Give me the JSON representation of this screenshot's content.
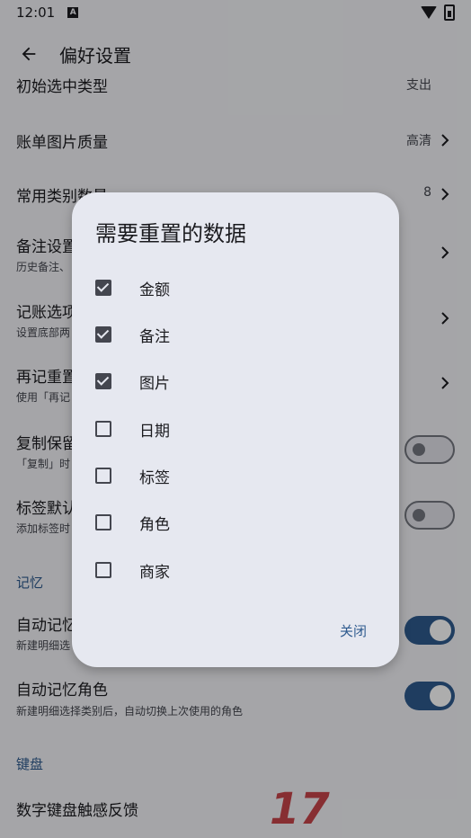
{
  "status_bar": {
    "time": "12:01",
    "notification_letter": "A"
  },
  "app_bar": {
    "title": "偏好设置"
  },
  "settings": {
    "partial_top": {
      "title": "初始选中类型",
      "value": "支出"
    },
    "bill_image_quality": {
      "title": "账单图片质量",
      "value": "高清"
    },
    "common_category_count": {
      "title": "常用类别数量",
      "value": "8"
    },
    "remark_settings": {
      "title": "备注设置",
      "subtitle": "历史备注、"
    },
    "entry_options": {
      "title": "记账选项",
      "subtitle": "设置底部两"
    },
    "record_again_reset": {
      "title": "再记重置",
      "subtitle": "使用「再记"
    },
    "copy_keep": {
      "title": "复制保留",
      "subtitle": "「复制」时"
    },
    "tag_default": {
      "title": "标签默认",
      "subtitle": "添加标签时"
    },
    "memory_section": "记忆",
    "auto_memory": {
      "title": "自动记忆",
      "subtitle": "新建明细选"
    },
    "auto_memory_role": {
      "title": "自动记忆角色",
      "subtitle": "新建明细选择类别后，自动切换上次使用的角色"
    },
    "keyboard_section": "键盘",
    "haptic": {
      "title": "数字键盘触感反馈"
    }
  },
  "dialog": {
    "title": "需要重置的数据",
    "options": [
      {
        "label": "金额",
        "checked": true
      },
      {
        "label": "备注",
        "checked": true
      },
      {
        "label": "图片",
        "checked": true
      },
      {
        "label": "日期",
        "checked": false
      },
      {
        "label": "标签",
        "checked": false
      },
      {
        "label": "角色",
        "checked": false
      },
      {
        "label": "商家",
        "checked": false
      }
    ],
    "close_label": "关闭"
  },
  "watermark": "17",
  "colors": {
    "accent": "#2e5a8e",
    "background": "#f3f4f8",
    "dialog": "#e6e8f0"
  }
}
